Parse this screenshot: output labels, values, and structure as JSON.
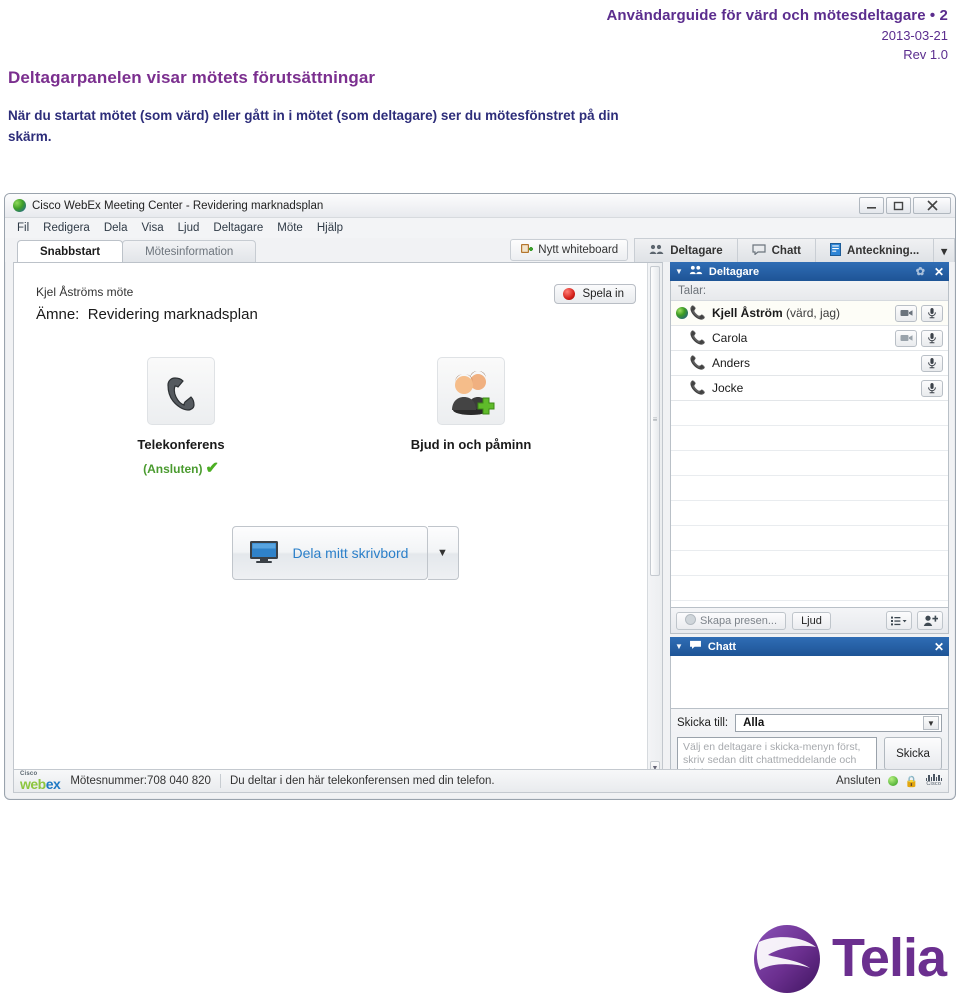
{
  "document": {
    "header_title": "Användarguide för värd och mötesdeltagare  •  2",
    "header_date": "2013-03-21",
    "header_rev": "Rev 1.0",
    "page_heading": "Deltagarpanelen visar mötets förutsättningar",
    "body_text": "När du startat mötet (som värd) eller gått in i mötet (som deltagare) ser du mötesfönstret på din skärm.",
    "accent_color": "#7b2f8f",
    "body_color": "#2d2d7a"
  },
  "webex": {
    "window_title": "Cisco WebEx Meeting Center - Revidering marknadsplan",
    "window_controls": {
      "minimize": "—",
      "maximize": "❐",
      "close": "✕"
    },
    "menu": [
      "Fil",
      "Redigera",
      "Dela",
      "Visa",
      "Ljud",
      "Deltagare",
      "Möte",
      "Hjälp"
    ],
    "tabs": [
      {
        "label": "Snabbstart",
        "active": true
      },
      {
        "label": "Mötesinformation",
        "active": false
      }
    ],
    "whiteboard_button": "Nytt whiteboard",
    "panel_tabs": [
      {
        "label": "Deltagare",
        "icon": "participants-icon"
      },
      {
        "label": "Chatt",
        "icon": "chat-bubble-icon"
      },
      {
        "label": "Anteckning...",
        "icon": "notes-icon"
      }
    ],
    "panel_tabs_caret": "▾",
    "quickstart": {
      "meeting_owner": "Kjel Åströms möte",
      "subject_label": "Ämne:",
      "subject_value": "Revidering marknadsplan",
      "record_button": "Spela in",
      "items": [
        {
          "label": "Telekonferens",
          "status": "(Ansluten)",
          "icon": "telephone-icon"
        },
        {
          "label": "Bjud in och påminn",
          "status": "",
          "icon": "invite-people-icon"
        }
      ],
      "share_button": "Dela mitt skrivbord",
      "share_caret": "▼"
    },
    "participants_panel": {
      "title": "Deltagare",
      "speaking_label": "Talar:",
      "rows": [
        {
          "name": "Kjell Åström",
          "role": " (värd, jag)",
          "host": true,
          "globe": true,
          "phone": true,
          "video": true,
          "mute": true
        },
        {
          "name": "Carola",
          "role": "",
          "host": false,
          "globe": false,
          "phone": true,
          "video": true,
          "mute": true
        },
        {
          "name": "Anders",
          "role": "",
          "host": false,
          "globe": false,
          "phone": true,
          "video": false,
          "mute": true
        },
        {
          "name": "Jocke",
          "role": "",
          "host": false,
          "globe": false,
          "phone": true,
          "video": false,
          "mute": true
        }
      ],
      "toolbar": {
        "present_button": "Skapa presen...",
        "audio_button": "Ljud",
        "list_button_caret": "▾"
      }
    },
    "chat_panel": {
      "title": "Chatt",
      "send_to_label": "Skicka till:",
      "send_to_value": "Alla",
      "message_placeholder": "Välj en deltagare i skicka-menyn först, skriv sedan ditt chattmeddelande och skicka...",
      "send_button": "Skicka"
    },
    "status_bar": {
      "brand_cisco": "Cisco",
      "brand_web": "web",
      "brand_ex": "ex",
      "meeting_number": "Mötesnummer:708 040 820",
      "message": "Du deltar i den här telekonferensen med din telefon.",
      "connection_status": "Ansluten"
    }
  },
  "footer": {
    "brand": "Telia",
    "brand_color": "#6b2f8f"
  }
}
